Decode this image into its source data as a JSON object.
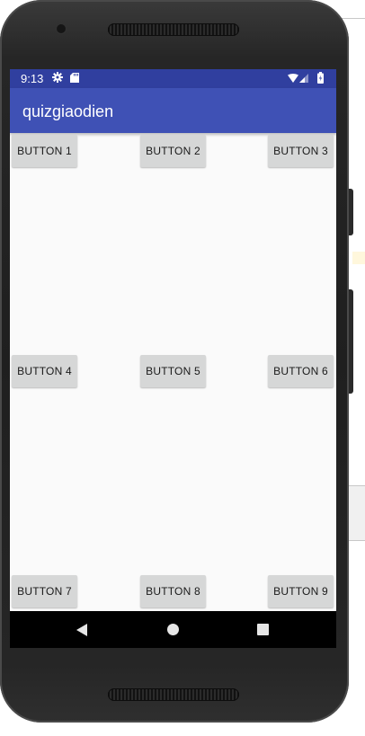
{
  "status_bar": {
    "time": "9:13",
    "icons": [
      "gear-icon",
      "sd-card-icon",
      "wifi-icon",
      "signal-icon",
      "battery-icon"
    ]
  },
  "app_bar": {
    "title": "quizgiaodien"
  },
  "buttons": [
    {
      "label": "BUTTON 1"
    },
    {
      "label": "BUTTON 2"
    },
    {
      "label": "BUTTON 3"
    },
    {
      "label": "BUTTON 4"
    },
    {
      "label": "BUTTON 5"
    },
    {
      "label": "BUTTON 6"
    },
    {
      "label": "BUTTON 7"
    },
    {
      "label": "BUTTON 8"
    },
    {
      "label": "BUTTON 9"
    }
  ],
  "nav_bar": {
    "icons": [
      "back-icon",
      "home-icon",
      "recents-icon"
    ]
  },
  "colors": {
    "status_bar": "#303f9f",
    "app_bar": "#3f51b5",
    "screen_background": "#fafafa",
    "button_background": "#d6d7d7",
    "nav_bar": "#000000"
  }
}
